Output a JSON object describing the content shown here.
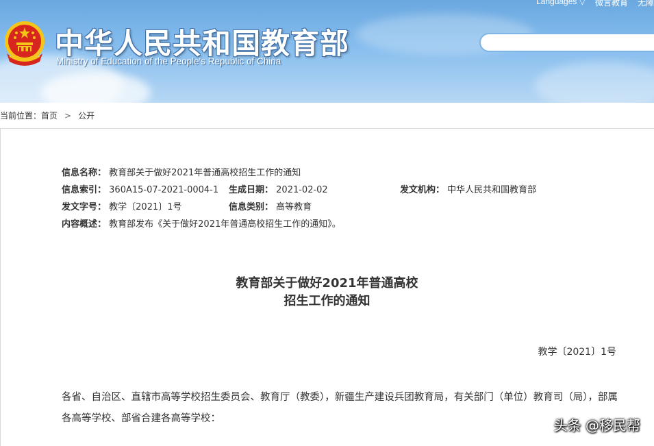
{
  "header": {
    "title": "中华人民共和国教育部",
    "subtitle": "Ministry of Education of the People's Republic of China",
    "top_links": [
      "Languages ▽",
      "微言教育",
      "无障"
    ],
    "emblem_icon": "national-emblem-icon"
  },
  "breadcrumb": {
    "prefix": "当前位置：",
    "items": [
      "首页",
      "公开"
    ],
    "separator": ">"
  },
  "meta": {
    "name_label": "信息名称：",
    "name_value": "教育部关于做好2021年普通高校招生工作的通知",
    "index_label": "信息索引：",
    "index_value": "360A15-07-2021-0004-1",
    "date_label": "生成日期：",
    "date_value": "2021-02-02",
    "issuer_label": "发文机构：",
    "issuer_value": "中华人民共和国教育部",
    "docno_label": "发文字号：",
    "docno_value": "教学〔2021〕1号",
    "category_label": "信息类别：",
    "category_value": "高等教育",
    "summary_label": "内容概述：",
    "summary_value": "教育部发布《关于做好2021年普通高校招生工作的通知》。"
  },
  "document": {
    "title_line1": "教育部关于做好2021年普通高校",
    "title_line2": "招生工作的通知",
    "number": "教学〔2021〕1号",
    "body": "各省、自治区、直辖市高等学校招生委员会、教育厅（教委），新疆生产建设兵团教育局，有关部门（单位）教育司（局），部属各高等学校、部省合建各高等学校："
  },
  "watermark": "头条 @移民帮",
  "colors": {
    "header_top": "#6aa8e0",
    "header_bottom": "#b6d7f4",
    "emblem_red": "#d7261e",
    "emblem_gold": "#f5c518"
  }
}
